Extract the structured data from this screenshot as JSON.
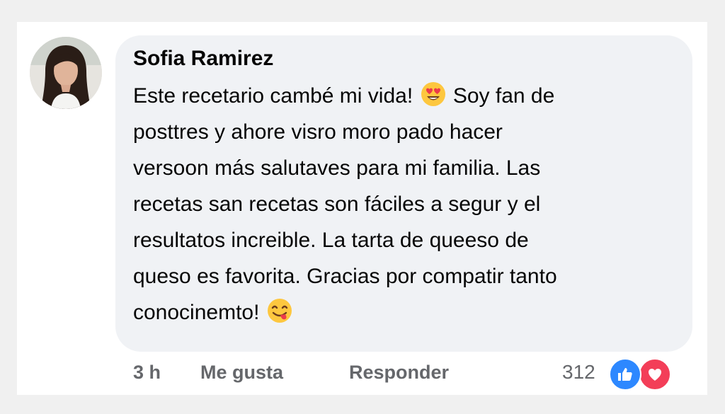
{
  "comment": {
    "author": "Sofia Ramirez",
    "text_lines": [
      "Este recetario cambé mi vida!",
      "Soy fan de",
      "posttres y ahore visro moro pado hacer",
      "versoon más salutaves para mi familia. Las",
      "recetas san recetas son fáciles a segur y el",
      "resultatos increible. La tarta de queeso de",
      "queso es favorita. Gracias por compatir tanto",
      "conocinemto!"
    ],
    "emojis": {
      "first": "heart-eyes-emoji",
      "last": "yum-emoji"
    }
  },
  "actions": {
    "time": "3 h",
    "like_label": "Me gusta",
    "reply_label": "Responder"
  },
  "reactions": {
    "count": "312",
    "types": [
      "like-reaction-icon",
      "love-reaction-icon"
    ],
    "colors": {
      "like": "#2d88ff",
      "love": "#f33e58"
    }
  },
  "colors": {
    "bubble": "#f0f2f5",
    "text": "#050505",
    "meta": "#65676b"
  }
}
